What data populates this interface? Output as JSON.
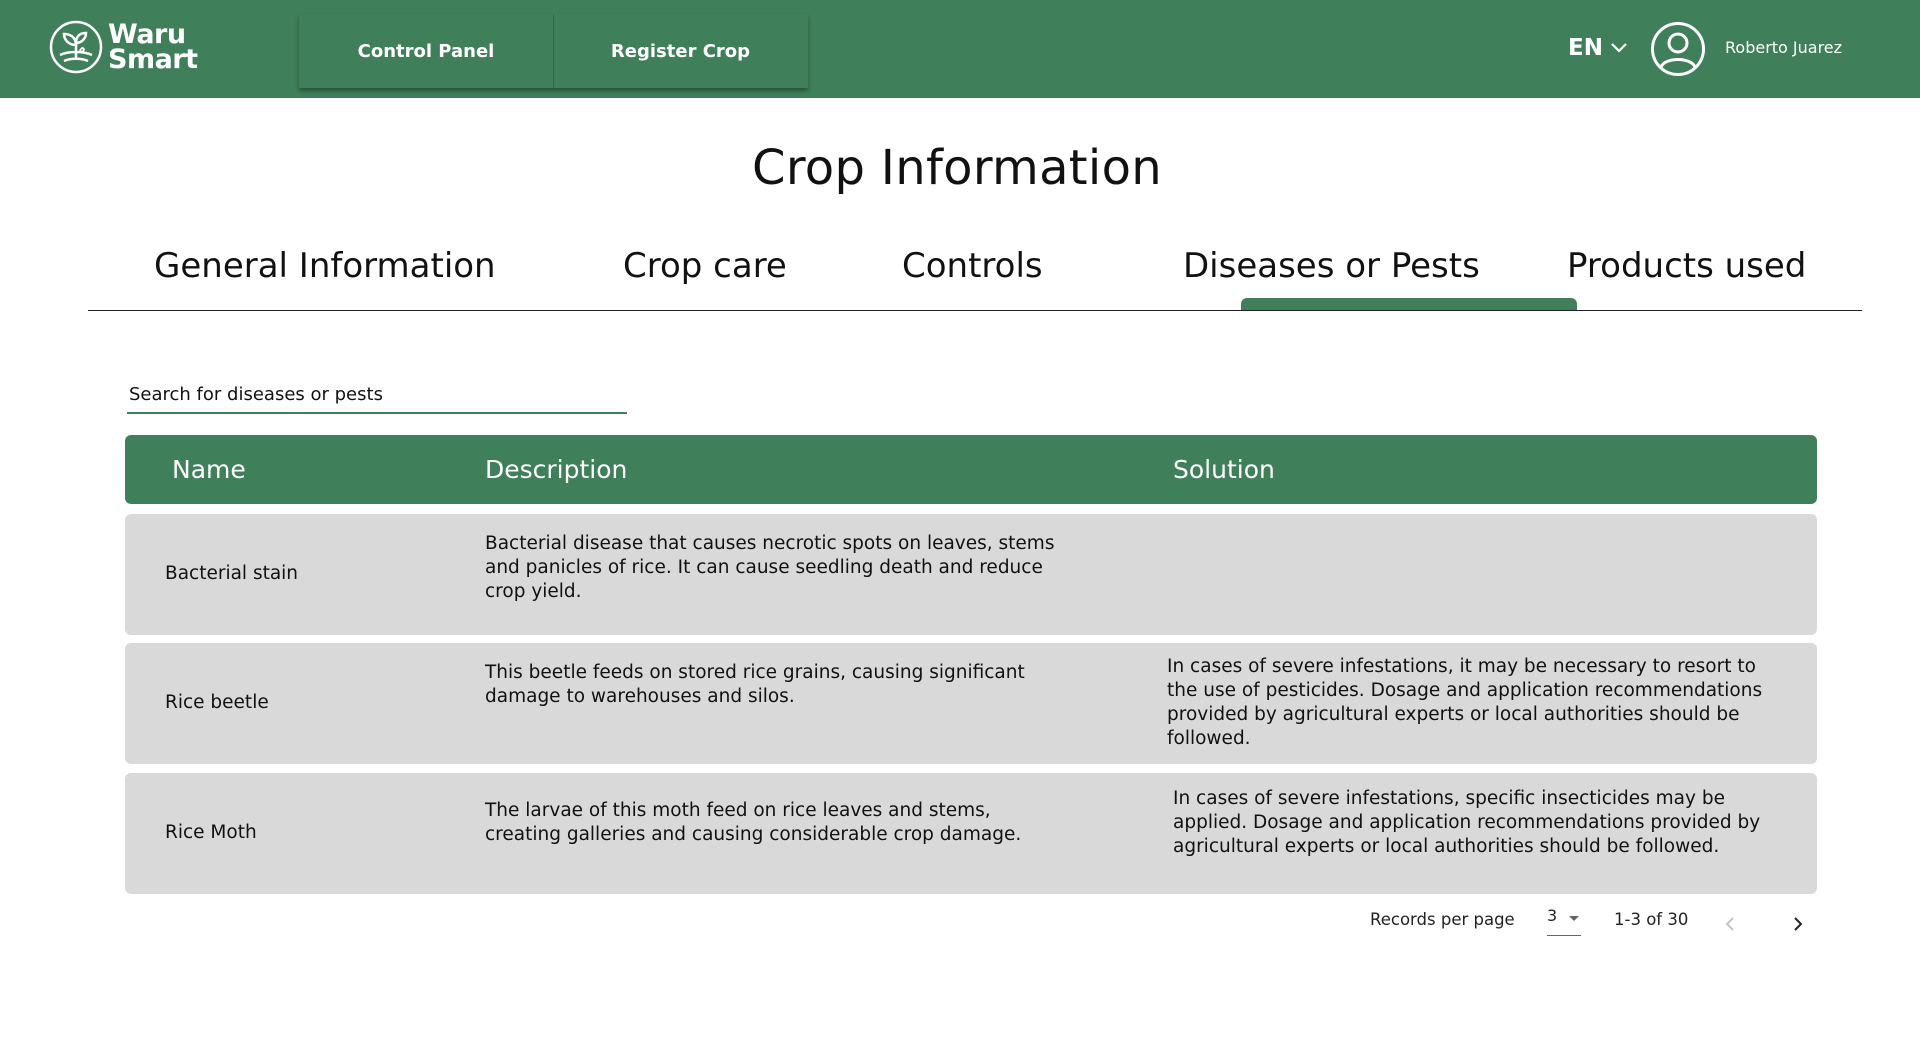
{
  "header": {
    "logo_line1": "Waru",
    "logo_line2": "Smart",
    "nav": [
      "Control Panel",
      "Register Crop"
    ],
    "language": "EN",
    "user_name": "Roberto Juarez"
  },
  "page_title": "Crop Information",
  "tabs": [
    "General Information",
    "Crop care",
    "Controls",
    "Diseases or Pests",
    "Products used"
  ],
  "active_tab": "Diseases or Pests",
  "search": {
    "placeholder": "Search for diseases or pests"
  },
  "table": {
    "headers": [
      "Name",
      "Description",
      "Solution"
    ],
    "rows": [
      {
        "name": "Bacterial stain",
        "description": "Bacterial disease that causes necrotic spots on leaves, stems and panicles of rice. It can cause seedling death and reduce crop yield.",
        "solution": ""
      },
      {
        "name": "Rice beetle",
        "description": "This beetle feeds on stored rice grains, causing significant damage to warehouses and silos.",
        "solution": "In cases of severe infestations, it may be necessary to resort to the use of pesticides. Dosage and application recommendations provided by agricultural experts or local authorities should be followed."
      },
      {
        "name": "Rice Moth",
        "description": "The larvae of this moth feed on rice leaves and stems, creating galleries and causing considerable crop damage.",
        "solution": "In cases of severe infestations, specific insecticides may be applied. Dosage and application recommendations provided by agricultural experts or local authorities should be followed."
      }
    ]
  },
  "pagination": {
    "label": "Records per page",
    "per_page": "3",
    "range": "1-3 of 30"
  },
  "colors": {
    "brand_green": "#3f7f5a",
    "row_bg": "#d9d9d9"
  }
}
